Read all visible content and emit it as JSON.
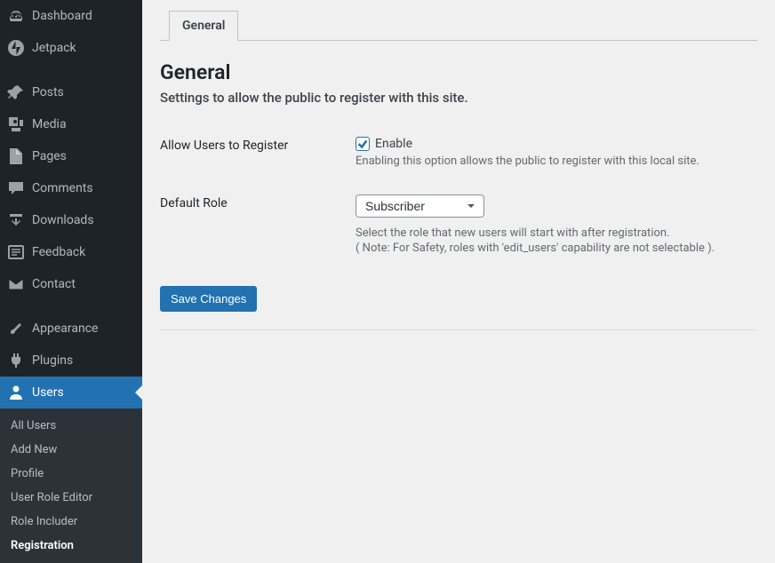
{
  "sidebar": {
    "items": [
      {
        "label": "Dashboard"
      },
      {
        "label": "Jetpack"
      },
      {
        "label": "Posts"
      },
      {
        "label": "Media"
      },
      {
        "label": "Pages"
      },
      {
        "label": "Comments"
      },
      {
        "label": "Downloads"
      },
      {
        "label": "Feedback"
      },
      {
        "label": "Contact"
      },
      {
        "label": "Appearance"
      },
      {
        "label": "Plugins"
      },
      {
        "label": "Users"
      }
    ],
    "submenu": [
      {
        "label": "All Users"
      },
      {
        "label": "Add New"
      },
      {
        "label": "Profile"
      },
      {
        "label": "User Role Editor"
      },
      {
        "label": "Role Includer"
      },
      {
        "label": "Registration"
      }
    ]
  },
  "tabs": [
    {
      "label": "General"
    }
  ],
  "page": {
    "title": "General",
    "subtitle": "Settings to allow the public to register with this site."
  },
  "form": {
    "allow_label": "Allow Users to Register",
    "enable_label": "Enable",
    "enable_desc": "Enabling this option allows the public to register with this local site.",
    "role_label": "Default Role",
    "role_value": "Subscriber",
    "role_desc": "Select the role that new users will start with after registration.",
    "role_note": "( Note: For Safety, roles with 'edit_users' capability are not selectable ).",
    "save": "Save Changes"
  }
}
